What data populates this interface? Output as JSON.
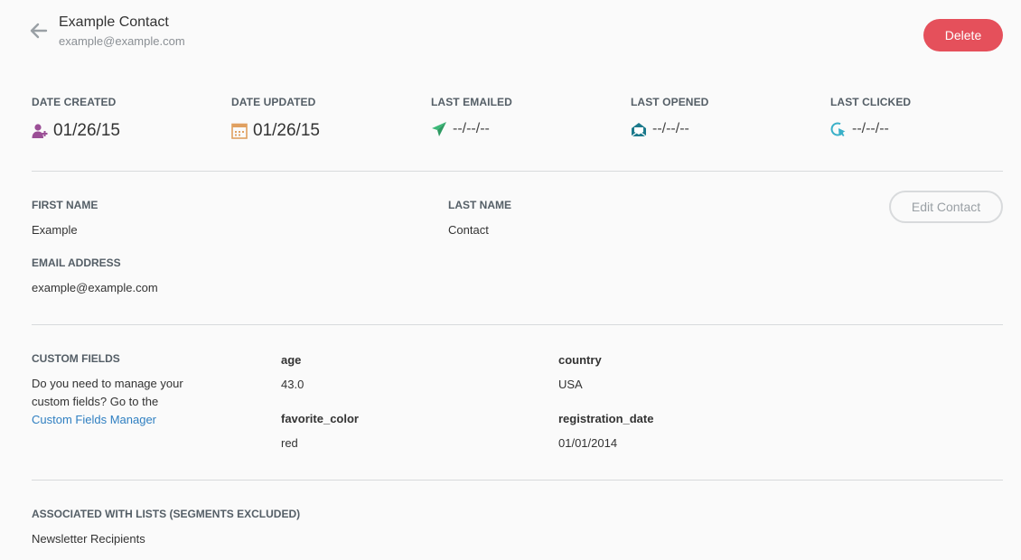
{
  "header": {
    "name": "Example Contact",
    "email": "example@example.com",
    "delete_label": "Delete"
  },
  "stats": [
    {
      "label": "DATE CREATED",
      "value": "01/26/15",
      "icon": "add-user-icon",
      "color": "#9b4f96"
    },
    {
      "label": "DATE UPDATED",
      "value": "01/26/15",
      "icon": "calendar-icon",
      "color": "#e0a060"
    },
    {
      "label": "LAST EMAILED",
      "value": "--/--/--",
      "icon": "paper-plane-icon",
      "color": "#3cb878"
    },
    {
      "label": "LAST OPENED",
      "value": "--/--/--",
      "icon": "open-envelope-icon",
      "color": "#1c7a8c"
    },
    {
      "label": "LAST CLICKED",
      "value": "--/--/--",
      "icon": "click-cursor-icon",
      "color": "#3ab0c8"
    }
  ],
  "details": {
    "first_name_label": "FIRST NAME",
    "first_name": "Example",
    "last_name_label": "LAST NAME",
    "last_name": "Contact",
    "email_label": "EMAIL ADDRESS",
    "email": "example@example.com",
    "edit_label": "Edit Contact"
  },
  "custom_fields": {
    "label": "CUSTOM FIELDS",
    "help_prefix": "Do you need to manage your custom fields? Go to the ",
    "help_link": "Custom Fields Manager",
    "fields": [
      {
        "name": "age",
        "value": "43.0"
      },
      {
        "name": "country",
        "value": "USA"
      },
      {
        "name": "favorite_color",
        "value": "red"
      },
      {
        "name": "registration_date",
        "value": "01/01/2014"
      }
    ]
  },
  "lists": {
    "label": "ASSOCIATED WITH LISTS (SEGMENTS EXCLUDED)",
    "items": [
      "Newsletter Recipients"
    ]
  },
  "colors": {
    "delete": "#e5505b",
    "link": "#2f7fc1",
    "label": "#545e66"
  }
}
